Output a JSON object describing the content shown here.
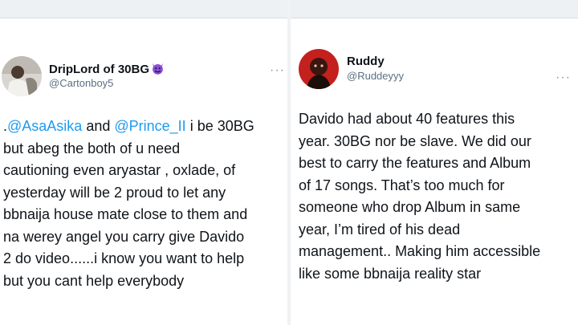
{
  "left_tweet": {
    "display_name": "DripLord of 30BG",
    "name_emoji": "smiling-devil-emoji",
    "handle": "@Cartonboy5",
    "more_label": "···",
    "body": {
      "line1_prefix": ".",
      "mention1": "@AsaAsika",
      "line1_mid": " and ",
      "mention2": "@Prince_II",
      "line1_suffix": " i be 30BG",
      "lines": [
        "but abeg the both of u need",
        "cautioning even aryastar , oxlade, of",
        "yesterday will be 2 proud to let any",
        "bbnaija house mate close to them and",
        "na werey angel you carry give Davido",
        "2 do video......i know you want to help",
        "but you cant help everybody"
      ]
    }
  },
  "right_tweet": {
    "display_name": "Ruddy",
    "handle": "@Ruddeyyy",
    "more_label": "···",
    "lines": [
      "Davido had about 40 features this",
      "year. 30BG nor be slave. We did our",
      "best to carry the features and Album",
      "of 17 songs. That’s too much for",
      "someone who drop Album in same",
      "year, I’m tired of his dead",
      "management.. Making him accessible",
      "like some bbnaija reality star"
    ]
  },
  "colors": {
    "mention_blue": "#1d9bf0",
    "handle_gray": "#5b7083",
    "emoji_purple": "#8a4fd6"
  }
}
